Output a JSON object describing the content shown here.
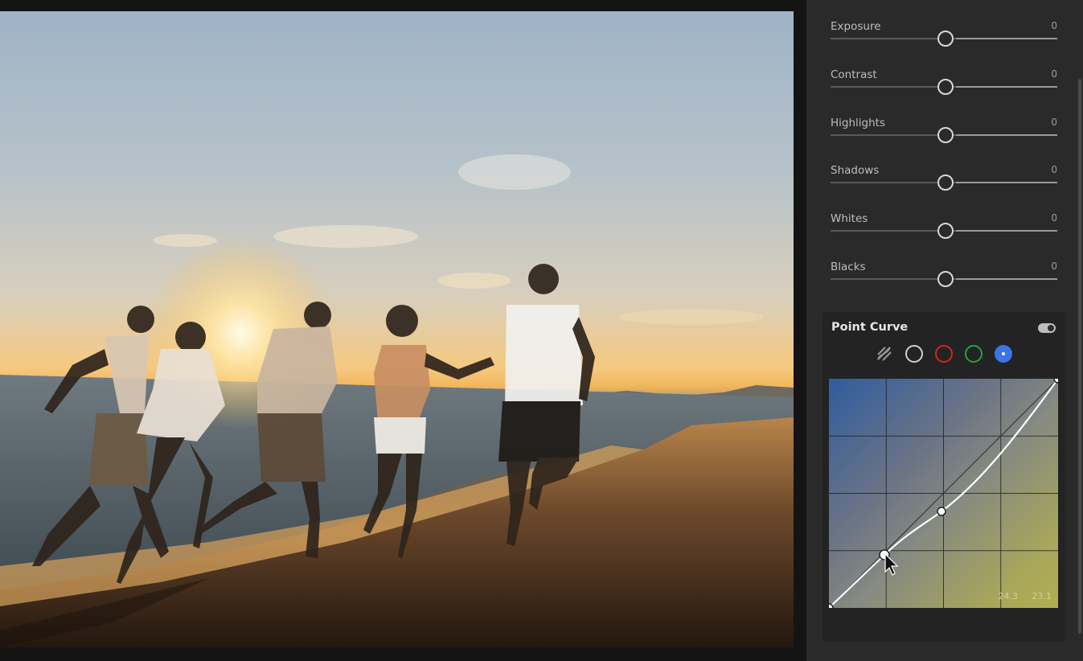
{
  "adjustments": [
    {
      "label": "Exposure",
      "value": "0"
    },
    {
      "label": "Contrast",
      "value": "0"
    },
    {
      "label": "Highlights",
      "value": "0"
    },
    {
      "label": "Shadows",
      "value": "0"
    },
    {
      "label": "Whites",
      "value": "0"
    },
    {
      "label": "Blacks",
      "value": "0"
    }
  ],
  "point_curve": {
    "title": "Point Curve",
    "enabled": true,
    "channels": [
      "parametric-icon",
      "rgb-channel",
      "red-channel",
      "green-channel",
      "blue-channel"
    ],
    "active_channel": "blue",
    "input_value": "24.3",
    "output_value": "23.1"
  },
  "colors": {
    "accent": "#3b74e8",
    "red_channel": "#d0261f",
    "green_channel": "#1fa53a"
  }
}
